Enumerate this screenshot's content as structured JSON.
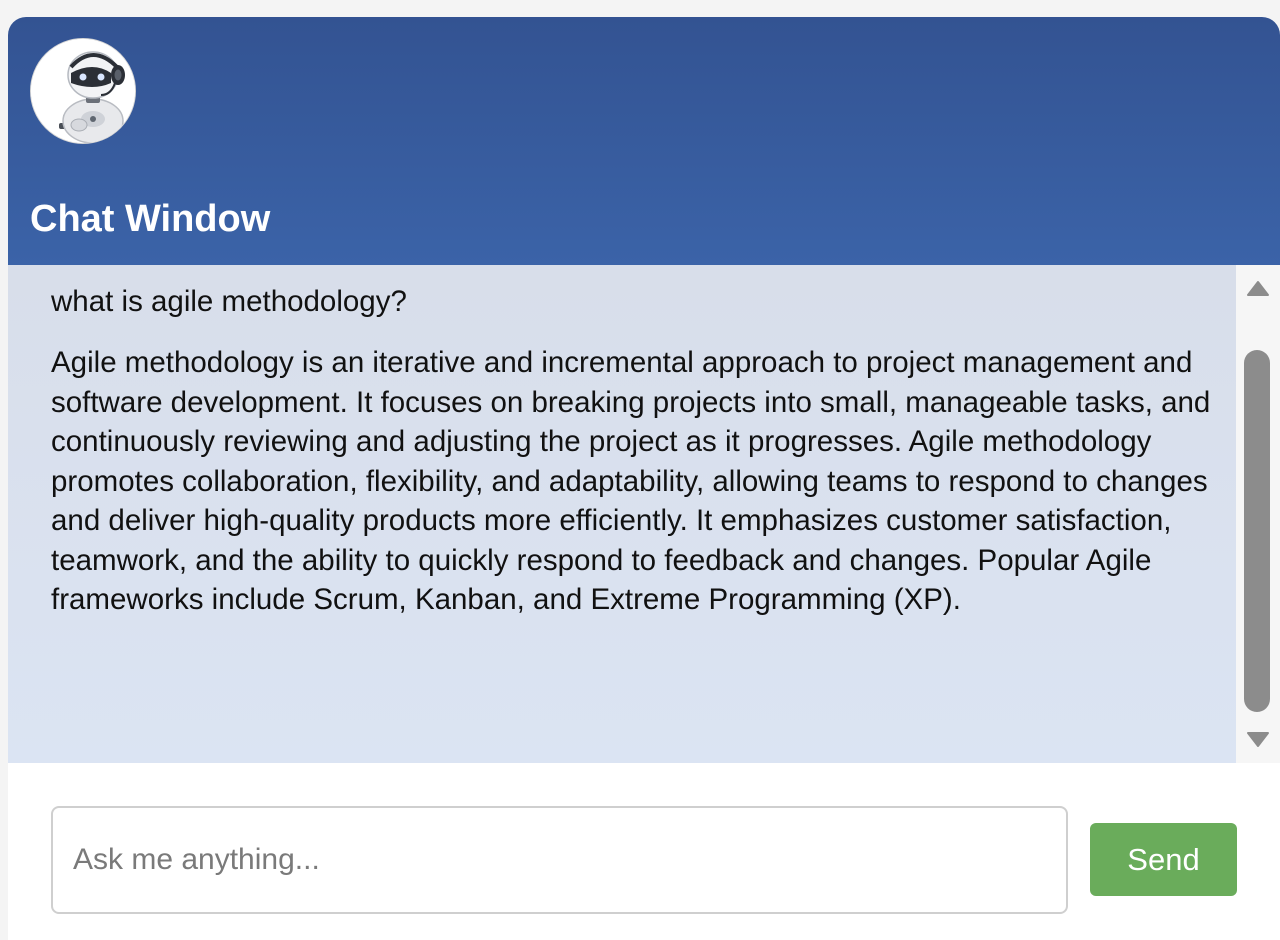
{
  "header": {
    "title": "Chat Window",
    "avatar_icon": "robot-avatar-icon",
    "colors": {
      "top": "#335392",
      "bottom": "#3b63a8"
    }
  },
  "messages": [
    {
      "role": "user",
      "text": "what is agile methodology?"
    },
    {
      "role": "bot",
      "text": "Agile methodology is an iterative and incremental approach to project management and software development. It focuses on breaking projects into small, manageable tasks, and continuously reviewing and adjusting the project as it progresses. Agile methodology promotes collaboration, flexibility, and adaptability, allowing teams to respond to changes and deliver high-quality products more efficiently. It emphasizes customer satisfaction, teamwork, and the ability to quickly respond to feedback and changes. Popular Agile frameworks include Scrum, Kanban, and Extreme Programming (XP)."
    }
  ],
  "composer": {
    "placeholder": "Ask me anything...",
    "value": "",
    "send_label": "Send",
    "send_color": "#6aac5b"
  }
}
